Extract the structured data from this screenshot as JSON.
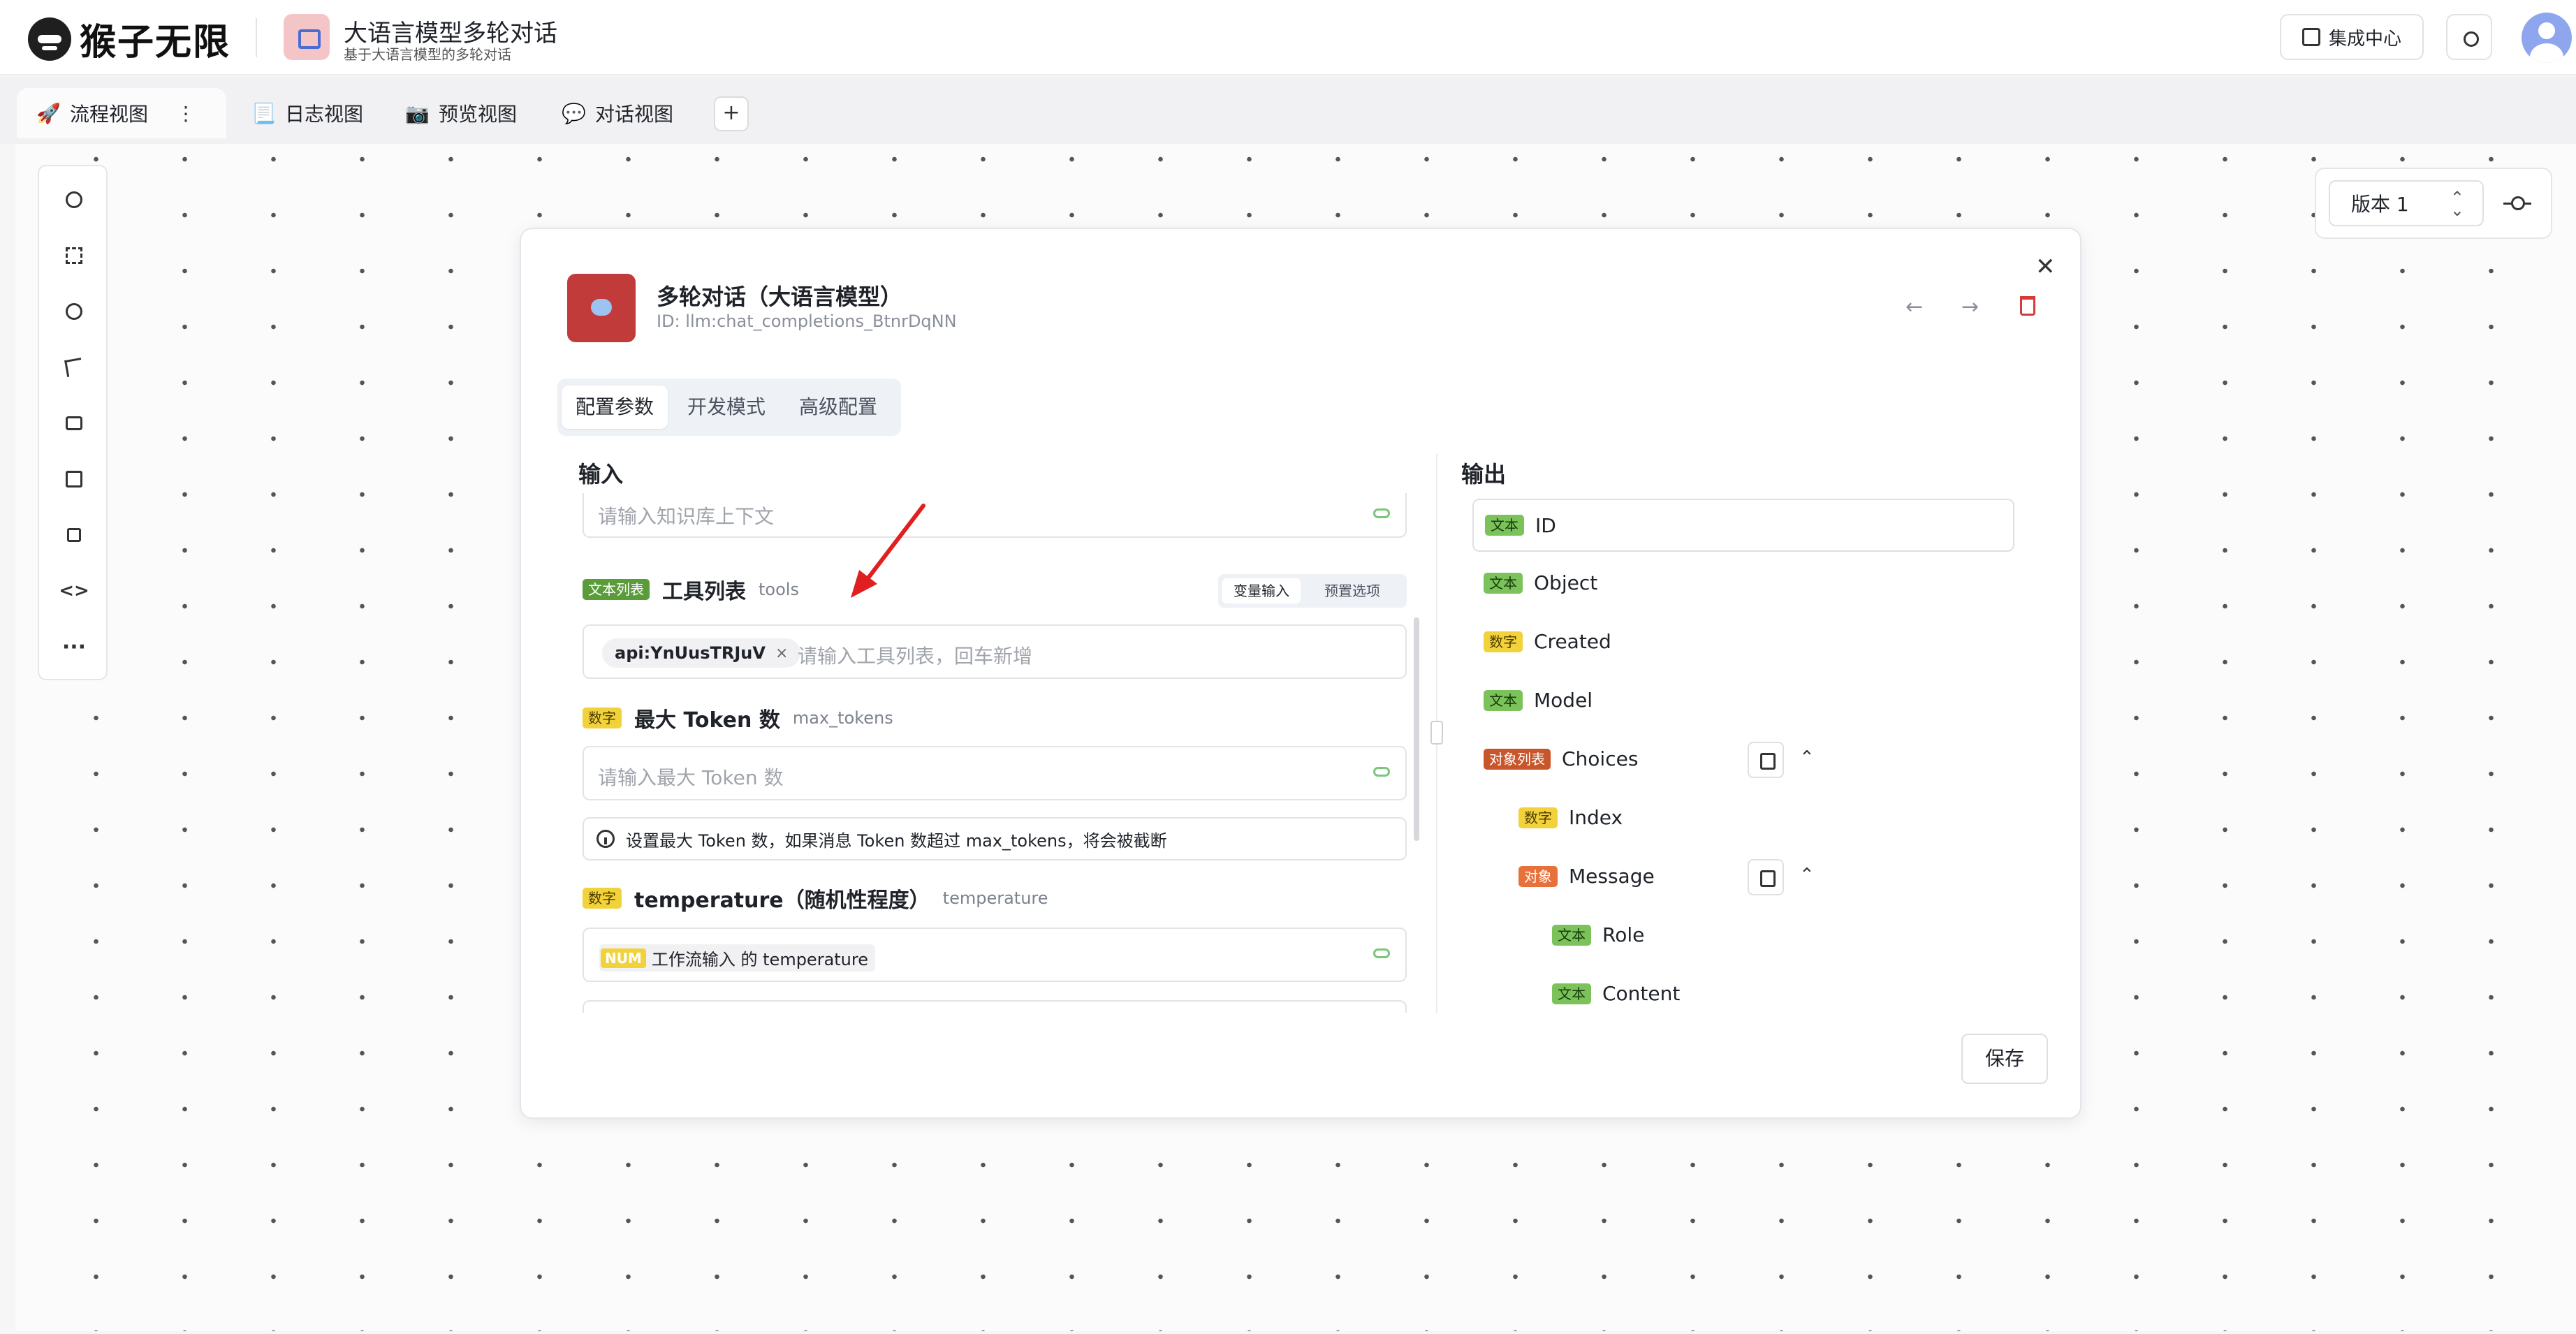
{
  "brand": {
    "name": "猴子无限"
  },
  "app": {
    "title": "大语言模型多轮对话",
    "subtitle": "基于大语言模型的多轮对话"
  },
  "header": {
    "market_label": "集成中心"
  },
  "tabs": [
    {
      "icon": "🚀",
      "label": "流程视图"
    },
    {
      "icon": "📃",
      "label": "日志视图"
    },
    {
      "icon": "📷",
      "label": "预览视图"
    },
    {
      "icon": "💬",
      "label": "对话视图"
    }
  ],
  "tab_add": "+",
  "version": {
    "label": "版本 1"
  },
  "node": {
    "title": "多轮对话（大语言模型）",
    "id_text": "ID: llm:chat_completions_BtnrDqNN",
    "tabs": [
      "配置参数",
      "开发模式",
      "高级配置"
    ]
  },
  "input": {
    "title": "输入",
    "knowledge_placeholder": "请输入知识库上下文",
    "tools": {
      "type_tag": "文本列表",
      "name": "工具列表",
      "key": "tools",
      "mode_options": [
        "变量输入",
        "预置选项"
      ],
      "chip": "api:YnUusTRJuV",
      "chip_close": "×",
      "placeholder": "请输入工具列表，回车新增"
    },
    "max_tokens": {
      "type_tag": "数字",
      "name": "最大 Token 数",
      "key": "max_tokens",
      "placeholder": "请输入最大 Token 数",
      "info": "设置最大 Token 数，如果消息 Token 数超过 max_tokens，将会被截断"
    },
    "temperature": {
      "type_tag": "数字",
      "name": "temperature（随机性程度）",
      "key": "temperature",
      "var_tag": "NUM",
      "var_text": "工作流输入 的 temperature"
    }
  },
  "output": {
    "title": "输出",
    "items": [
      {
        "tag": "文本",
        "name": "ID"
      },
      {
        "tag": "文本",
        "name": "Object"
      },
      {
        "tag": "数字",
        "name": "Created"
      },
      {
        "tag": "文本",
        "name": "Model"
      },
      {
        "tag": "对象列表",
        "name": "Choices"
      },
      {
        "tag": "数字",
        "name": "Index"
      },
      {
        "tag": "对象",
        "name": "Message"
      },
      {
        "tag": "文本",
        "name": "Role"
      },
      {
        "tag": "文本",
        "name": "Content"
      }
    ]
  },
  "save_label": "保存",
  "colors": {
    "text_tag": "#7cc25b",
    "number_tag": "#f2d23a",
    "object_tag": "#e8703a",
    "object_list_tag": "#c9552b",
    "danger": "#d63b3b",
    "node_icon": "#c23b3b"
  }
}
